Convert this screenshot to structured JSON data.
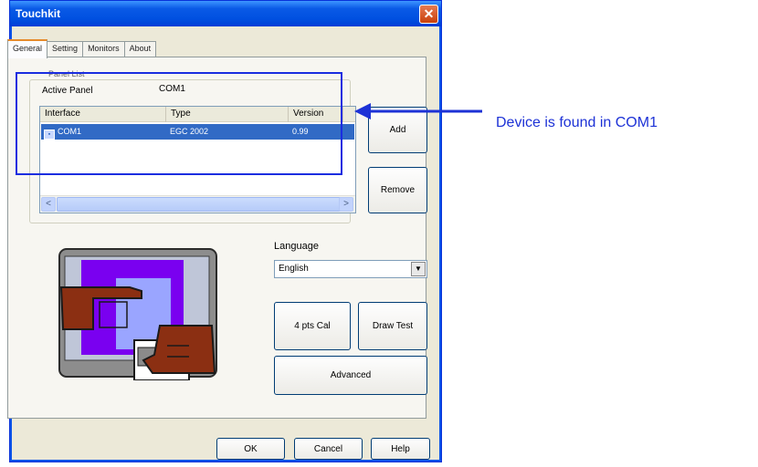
{
  "window": {
    "title": "Touchkit"
  },
  "tabs": [
    {
      "label": "General"
    },
    {
      "label": "Setting"
    },
    {
      "label": "Monitors"
    },
    {
      "label": "About"
    }
  ],
  "panel_list": {
    "legend": "Panel List",
    "active_panel_label": "Active Panel",
    "active_panel_value": "COM1",
    "columns": [
      "Interface",
      "Type",
      "Version"
    ],
    "rows": [
      {
        "interface": "COM1",
        "type": "EGC 2002",
        "version": "0.99"
      }
    ]
  },
  "buttons": {
    "add": "Add",
    "remove": "Remove",
    "four_pts_cal": "4 pts Cal",
    "draw_test": "Draw Test",
    "advanced": "Advanced",
    "ok": "OK",
    "cancel": "Cancel",
    "help": "Help"
  },
  "language": {
    "label": "Language",
    "selected": "English"
  },
  "annotation": {
    "text": "Device is found in COM1"
  },
  "colors": {
    "title_bar": "#0a5ae6",
    "selection": "#316ac5",
    "annotation": "#1d32d6",
    "illustration_purple": "#7a00f0"
  }
}
